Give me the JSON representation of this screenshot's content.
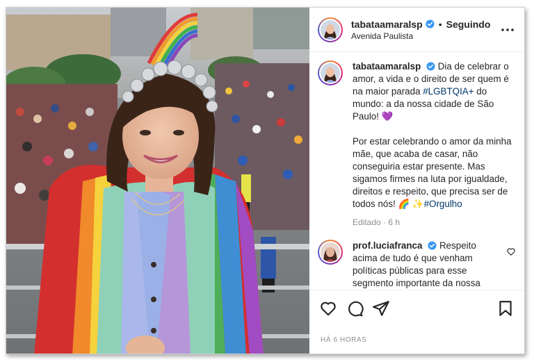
{
  "post": {
    "author": "tabataamaralsp",
    "follow_status": "Seguindo",
    "dot": "•",
    "location": "Avenida Paulista"
  },
  "caption": {
    "username": "tabataamaralsp",
    "text_1": "Dia de celebrar o amor, a vida e o direito de ser quem é na maior parada ",
    "hashtag_1": "#LGBTQIA+",
    "text_2": " do mundo: a da nossa cidade de São Paulo! 💜",
    "text_3": "Por estar celebrando o amor da minha mãe, que acaba de casar, não conseguiria estar presente. Mas sigamos firmes na luta por igualdade, direitos e respeito, que precisa ser de todos nós! 🌈",
    "emoji_sparkle": "✨",
    "hashtag_2": "#Orgulho",
    "meta": "Editado · 6 h"
  },
  "comment": {
    "username": "prof.luciafranca",
    "text": "Respeito acima de tudo é que venham políticas públicas para esse segmento importante da nossa sociedade 🏳️‍🌈"
  },
  "footer": {
    "timestamp": "HÁ 6 HORAS"
  },
  "icons": {
    "like": "heart-icon",
    "comment": "comment-icon",
    "share": "send-icon",
    "save": "bookmark-icon",
    "more": "more-options-icon",
    "verified": "verified-badge-icon"
  },
  "colors": {
    "verified": "#3897f0",
    "hashtag": "#00376b",
    "muted": "#8e8e8e",
    "text": "#262626"
  }
}
